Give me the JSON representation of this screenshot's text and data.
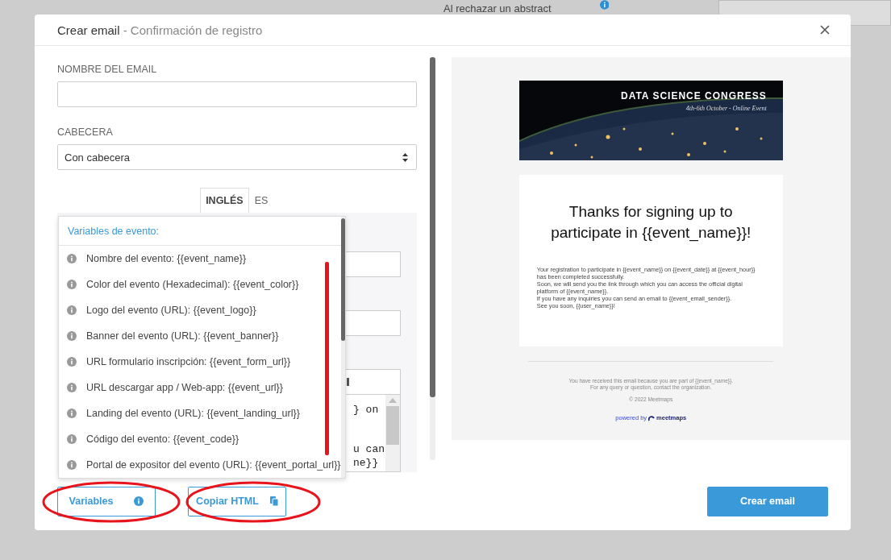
{
  "background": {
    "row_label": "Al rechazar un abstract"
  },
  "dialog": {
    "title": "Crear email",
    "subtitle": "- Confirmación de registro"
  },
  "form": {
    "name_label": "NOMBRE DEL EMAIL",
    "header_label": "CABECERA",
    "header_value": "Con cabecera"
  },
  "tabs": [
    {
      "label": "INGLÉS",
      "selected": true
    },
    {
      "label": "ES",
      "selected": false
    }
  ],
  "editor": {
    "lines": [
      "} on",
      "u can",
      "ne}}"
    ]
  },
  "variables_menu": {
    "title": "Variables de evento:",
    "items": [
      {
        "label": "Nombre del evento:",
        "variable": "{{event_name}}"
      },
      {
        "label": "Color del evento (Hexadecimal):",
        "variable": "{{event_color}}"
      },
      {
        "label": "Logo del evento (URL):",
        "variable": "{{event_logo}}"
      },
      {
        "label": "Banner del evento (URL):",
        "variable": "{{event_banner}}"
      },
      {
        "label": "URL formulario inscripción:",
        "variable": "{{event_form_url}}"
      },
      {
        "label": "URL descargar app / Web-app:",
        "variable": "{{event_url}}"
      },
      {
        "label": "Landing del evento (URL):",
        "variable": "{{event_landing_url}}"
      },
      {
        "label": "Código del evento:",
        "variable": "{{event_code}}"
      },
      {
        "label": "Portal de expositor del evento (URL):",
        "variable": "{{event_portal_url}}"
      }
    ]
  },
  "preview": {
    "banner_title": "DATA SCIENCE CONGRESS",
    "banner_subtitle": "4th-6th October - Online Event",
    "heading": "Thanks for signing up to participate in {{event_name}}!",
    "body": [
      "Your registration to participate in {{event_name}} on {{event_date}} at {{event_hour}} has been completed successfully.",
      "Soon, we will send you the link through which you can access the official digital platform of {{event_name}}.",
      "If you have any inquiries you can send an email to {{event_email_sender}}.",
      "See you soon, {{user_name}}!"
    ],
    "footer": [
      "You have received this email because you are part of {{event_name}}.",
      "For any query or question, contact the organization."
    ],
    "copyright": "© 2022 Meetmaps",
    "powered_by": "powered by",
    "brand": "meetmaps"
  },
  "buttons": [
    {
      "kind": "info",
      "label": "Variables"
    },
    {
      "kind": "copy",
      "label": "Copiar HTML"
    },
    {
      "kind": "primary",
      "label": "Crear email"
    }
  ]
}
